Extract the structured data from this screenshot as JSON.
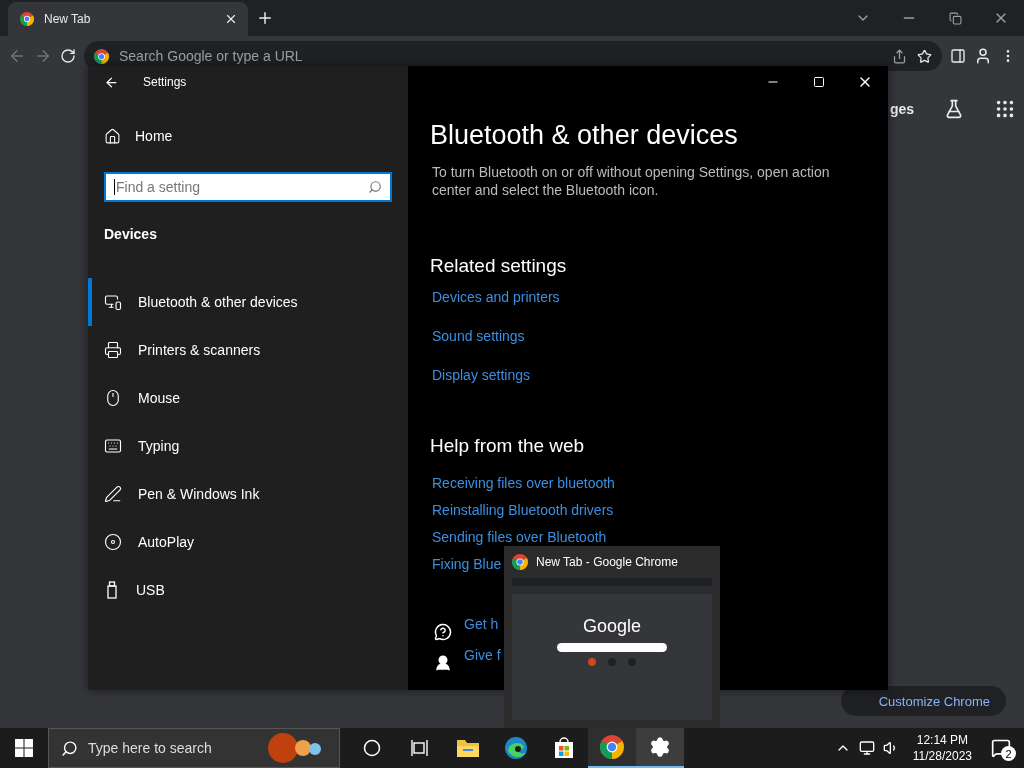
{
  "browser": {
    "tab": {
      "title": "New Tab",
      "selected": true
    },
    "omnibox": {
      "placeholder": "Search Google or type a URL"
    },
    "header_link": "ges",
    "customize_button": "Customize Chrome"
  },
  "settings": {
    "title": "Settings",
    "home": "Home",
    "search": {
      "placeholder": "Find a setting"
    },
    "section": "Devices",
    "nav": [
      {
        "kind": "bluetooth",
        "label": "Bluetooth & other devices",
        "selected": true
      },
      {
        "kind": "printer",
        "label": "Printers & scanners",
        "selected": false
      },
      {
        "kind": "mouse",
        "label": "Mouse",
        "selected": false
      },
      {
        "kind": "typing",
        "label": "Typing",
        "selected": false
      },
      {
        "kind": "pen",
        "label": "Pen & Windows Ink",
        "selected": false
      },
      {
        "kind": "autoplay",
        "label": "AutoPlay",
        "selected": false
      },
      {
        "kind": "usb",
        "label": "USB",
        "selected": false
      }
    ],
    "page": {
      "title": "Bluetooth & other devices",
      "description": "To turn Bluetooth on or off without opening Settings, open action center and select the Bluetooth icon.",
      "related": {
        "heading": "Related settings",
        "links": [
          "Devices and printers",
          "Sound settings",
          "Display settings"
        ]
      },
      "help": {
        "heading": "Help from the web",
        "links": [
          "Receiving files over bluetooth",
          "Reinstalling Bluetooth drivers",
          "Sending files over Bluetooth",
          "Fixing Blue"
        ]
      },
      "support": [
        {
          "kind": "help",
          "label": "Get h"
        },
        {
          "kind": "feedback",
          "label": "Give f"
        }
      ]
    }
  },
  "preview": {
    "title": "New Tab - Google Chrome",
    "logo": "Google"
  },
  "taskbar": {
    "search_placeholder": "Type here to search",
    "apps": [
      {
        "kind": "cortana",
        "running": false,
        "selected": false
      },
      {
        "kind": "taskview",
        "running": false,
        "selected": false
      },
      {
        "kind": "explorer",
        "running": false,
        "selected": false
      },
      {
        "kind": "edge",
        "running": false,
        "selected": false
      },
      {
        "kind": "store",
        "running": false,
        "selected": false
      },
      {
        "kind": "chrome",
        "running": true,
        "selected": false
      },
      {
        "kind": "settings",
        "running": true,
        "selected": true
      }
    ],
    "time": "12:14 PM",
    "date": "11/28/2023",
    "notifications": "2"
  }
}
